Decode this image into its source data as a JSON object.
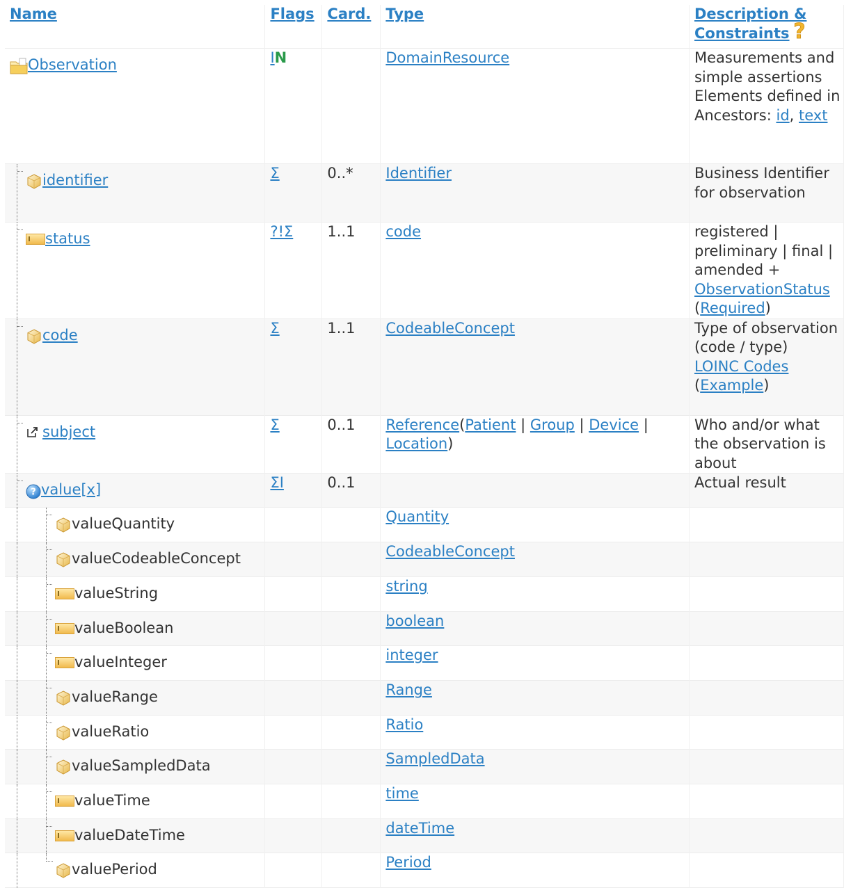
{
  "headers": {
    "name": "Name",
    "flags": "Flags",
    "card": "Card.",
    "type": "Type",
    "desc_line1": "Description &",
    "desc_line2": "Constraints"
  },
  "rows": [
    {
      "name": "Observation",
      "icon": "folder-icon",
      "flags_a": "I",
      "flags_b": "N",
      "card": "",
      "type": "DomainResource",
      "desc": "Measurements and simple assertions",
      "desc2": "Elements defined in Ancestors: ",
      "link1": "id",
      "sep": ", ",
      "link2": "text"
    },
    {
      "name": "identifier",
      "icon": "cube-icon",
      "flags": "Σ",
      "card": "0..*",
      "type": "Identifier",
      "desc": "Business Identifier for observation"
    },
    {
      "name": "status",
      "icon": "primitive-icon",
      "flags": "?!Σ",
      "card": "1..1",
      "type": "code",
      "desc": "registered | preliminary | final | amended +",
      "vs": "ObservationStatus",
      "open": "(",
      "strength": "Required",
      "close": ")"
    },
    {
      "name": "code",
      "icon": "cube-icon",
      "flags": "Σ",
      "card": "1..1",
      "type": "CodeableConcept",
      "desc": "Type of observation (code / type)",
      "vs": "LOINC Codes",
      "open": "(",
      "strength": "Example",
      "close": ")"
    },
    {
      "name": "subject",
      "icon": "reference-icon",
      "flags": "Σ",
      "card": "0..1",
      "type": "Reference",
      "t_open": "(",
      "targets": [
        "Patient",
        "Group",
        "Device",
        "Location"
      ],
      "t_sep": " | ",
      "t_close": ")",
      "desc": "Who and/or what the observation is about"
    },
    {
      "name": "value[x]",
      "icon": "choice-icon",
      "flags": "ΣI",
      "card": "0..1",
      "type": "",
      "desc": "Actual result"
    },
    {
      "name": "valueQuantity",
      "icon": "cube-icon",
      "type": "Quantity"
    },
    {
      "name": "valueCodeableConcept",
      "icon": "cube-icon",
      "type": "CodeableConcept"
    },
    {
      "name": "valueString",
      "icon": "primitive-icon",
      "type": "string"
    },
    {
      "name": "valueBoolean",
      "icon": "primitive-icon",
      "type": "boolean"
    },
    {
      "name": "valueInteger",
      "icon": "primitive-icon",
      "type": "integer"
    },
    {
      "name": "valueRange",
      "icon": "cube-icon",
      "type": "Range"
    },
    {
      "name": "valueRatio",
      "icon": "cube-icon",
      "type": "Ratio"
    },
    {
      "name": "valueSampledData",
      "icon": "cube-icon",
      "type": "SampledData"
    },
    {
      "name": "valueTime",
      "icon": "primitive-icon",
      "type": "time"
    },
    {
      "name": "valueDateTime",
      "icon": "primitive-icon",
      "type": "dateTime"
    },
    {
      "name": "valuePeriod",
      "icon": "cube-icon",
      "type": "Period"
    }
  ]
}
